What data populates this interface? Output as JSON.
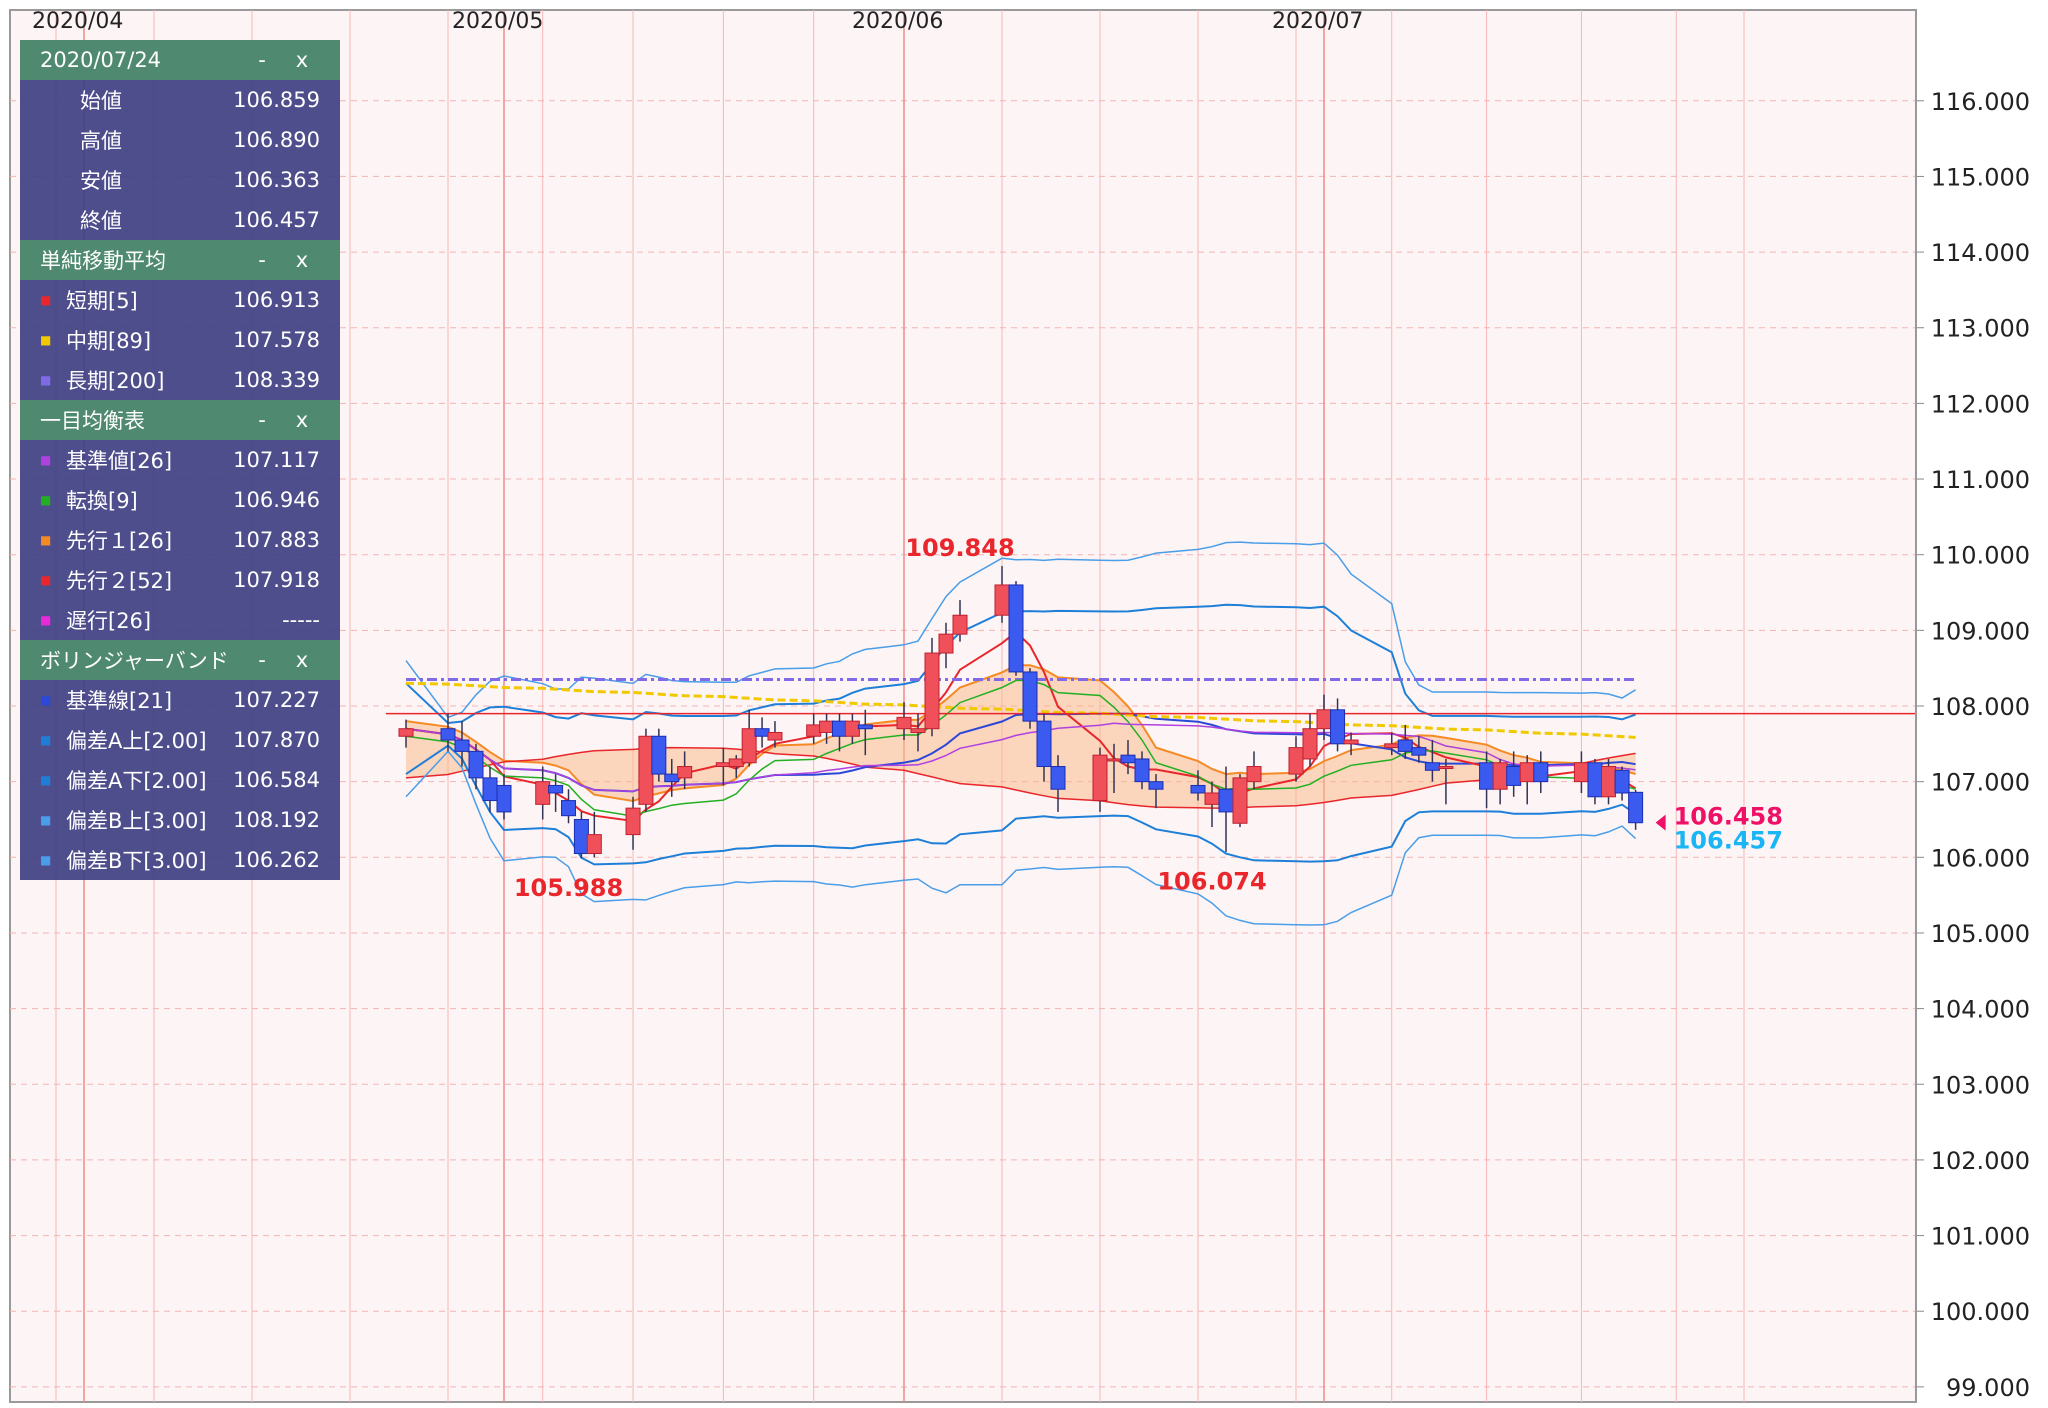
{
  "chart_data": {
    "type": "candlestick",
    "ylim": [
      98.8,
      117.2
    ],
    "y_ticks": [
      "99.000",
      "100.000",
      "101.000",
      "102.000",
      "103.000",
      "104.000",
      "105.000",
      "106.000",
      "107.000",
      "108.000",
      "109.000",
      "110.000",
      "111.000",
      "112.000",
      "113.000",
      "114.000",
      "115.000",
      "116.000"
    ],
    "x_month_labels": [
      "2020/04",
      "2020/05",
      "2020/06",
      "2020/07"
    ],
    "grid": true,
    "annotations": [
      {
        "text": "109.848",
        "x": "2020/06/05",
        "y": 109.848,
        "color": "#e8262b"
      },
      {
        "text": "105.988",
        "x": "2020/05/06",
        "y": 105.988,
        "color": "#e8262b"
      },
      {
        "text": "106.074",
        "x": "2020/06/23",
        "y": 106.074,
        "color": "#e8262b"
      }
    ],
    "price_labels": {
      "bid": "106.458",
      "ask": "106.457",
      "bid_color": "#ee1166",
      "ask_color": "#1ab5f5"
    },
    "horizontal_line": {
      "value": 107.9,
      "color": "#e8262b"
    },
    "candles": [
      {
        "d": "2020/04/24",
        "o": 107.6,
        "h": 107.82,
        "l": 107.45,
        "c": 107.7
      },
      {
        "d": "2020/04/27",
        "o": 107.7,
        "h": 107.9,
        "l": 107.4,
        "c": 107.55
      },
      {
        "d": "2020/04/28",
        "o": 107.55,
        "h": 107.8,
        "l": 107.2,
        "c": 107.4
      },
      {
        "d": "2020/04/29",
        "o": 107.4,
        "h": 107.5,
        "l": 106.9,
        "c": 107.05
      },
      {
        "d": "2020/04/30",
        "o": 107.05,
        "h": 107.2,
        "l": 106.6,
        "c": 106.75
      },
      {
        "d": "2020/05/01",
        "o": 106.95,
        "h": 107.1,
        "l": 106.5,
        "c": 106.6
      },
      {
        "d": "2020/05/04",
        "o": 106.7,
        "h": 107.2,
        "l": 106.5,
        "c": 107.0
      },
      {
        "d": "2020/05/05",
        "o": 106.95,
        "h": 107.1,
        "l": 106.6,
        "c": 106.85
      },
      {
        "d": "2020/05/06",
        "o": 106.75,
        "h": 106.9,
        "l": 106.45,
        "c": 106.55
      },
      {
        "d": "2020/05/07",
        "o": 106.5,
        "h": 106.6,
        "l": 105.99,
        "c": 106.05
      },
      {
        "d": "2020/05/08",
        "o": 106.05,
        "h": 106.6,
        "l": 106.0,
        "c": 106.3
      },
      {
        "d": "2020/05/11",
        "o": 106.3,
        "h": 106.8,
        "l": 106.1,
        "c": 106.65
      },
      {
        "d": "2020/05/12",
        "o": 106.7,
        "h": 107.7,
        "l": 106.6,
        "c": 107.6
      },
      {
        "d": "2020/05/13",
        "o": 107.6,
        "h": 107.7,
        "l": 107.0,
        "c": 107.1
      },
      {
        "d": "2020/05/14",
        "o": 107.1,
        "h": 107.3,
        "l": 106.8,
        "c": 107.0
      },
      {
        "d": "2020/05/15",
        "o": 107.05,
        "h": 107.4,
        "l": 106.9,
        "c": 107.2
      },
      {
        "d": "2020/05/18",
        "o": 107.2,
        "h": 107.45,
        "l": 106.95,
        "c": 107.25
      },
      {
        "d": "2020/05/19",
        "o": 107.2,
        "h": 107.35,
        "l": 107.05,
        "c": 107.3
      },
      {
        "d": "2020/05/20",
        "o": 107.25,
        "h": 107.95,
        "l": 107.2,
        "c": 107.7
      },
      {
        "d": "2020/05/21",
        "o": 107.7,
        "h": 107.85,
        "l": 107.45,
        "c": 107.6
      },
      {
        "d": "2020/05/22",
        "o": 107.55,
        "h": 107.8,
        "l": 107.45,
        "c": 107.65
      },
      {
        "d": "2020/05/25",
        "o": 107.6,
        "h": 107.9,
        "l": 107.5,
        "c": 107.75
      },
      {
        "d": "2020/05/26",
        "o": 107.65,
        "h": 107.9,
        "l": 107.5,
        "c": 107.8
      },
      {
        "d": "2020/05/27",
        "o": 107.8,
        "h": 107.9,
        "l": 107.4,
        "c": 107.6
      },
      {
        "d": "2020/05/28",
        "o": 107.6,
        "h": 107.9,
        "l": 107.5,
        "c": 107.8
      },
      {
        "d": "2020/05/29",
        "o": 107.75,
        "h": 107.95,
        "l": 107.35,
        "c": 107.7
      },
      {
        "d": "2020/06/01",
        "o": 107.7,
        "h": 108.05,
        "l": 107.55,
        "c": 107.85
      },
      {
        "d": "2020/06/02",
        "o": 107.65,
        "h": 107.9,
        "l": 107.4,
        "c": 107.7
      },
      {
        "d": "2020/06/03",
        "o": 107.7,
        "h": 108.9,
        "l": 107.6,
        "c": 108.7
      },
      {
        "d": "2020/06/04",
        "o": 108.7,
        "h": 109.1,
        "l": 108.5,
        "c": 108.95
      },
      {
        "d": "2020/06/05",
        "o": 108.95,
        "h": 109.4,
        "l": 108.85,
        "c": 109.2
      },
      {
        "d": "2020/06/08",
        "o": 109.2,
        "h": 109.85,
        "l": 109.1,
        "c": 109.6
      },
      {
        "d": "2020/06/09",
        "o": 109.6,
        "h": 109.65,
        "l": 108.4,
        "c": 108.45
      },
      {
        "d": "2020/06/10",
        "o": 108.45,
        "h": 108.5,
        "l": 107.7,
        "c": 107.8
      },
      {
        "d": "2020/06/11",
        "o": 107.8,
        "h": 107.9,
        "l": 107.0,
        "c": 107.2
      },
      {
        "d": "2020/06/12",
        "o": 107.2,
        "h": 107.35,
        "l": 106.6,
        "c": 106.9
      },
      {
        "d": "2020/06/15",
        "o": 106.75,
        "h": 107.45,
        "l": 106.6,
        "c": 107.35
      },
      {
        "d": "2020/06/16",
        "o": 107.3,
        "h": 107.5,
        "l": 106.85,
        "c": 107.3
      },
      {
        "d": "2020/06/17",
        "o": 107.35,
        "h": 107.55,
        "l": 107.1,
        "c": 107.25
      },
      {
        "d": "2020/06/18",
        "o": 107.3,
        "h": 107.4,
        "l": 106.9,
        "c": 107.0
      },
      {
        "d": "2020/06/19",
        "o": 107.0,
        "h": 107.1,
        "l": 106.65,
        "c": 106.9
      },
      {
        "d": "2020/06/22",
        "o": 106.95,
        "h": 107.15,
        "l": 106.75,
        "c": 106.85
      },
      {
        "d": "2020/06/23",
        "o": 106.7,
        "h": 107.0,
        "l": 106.4,
        "c": 106.85
      },
      {
        "d": "2020/06/24",
        "o": 106.9,
        "h": 107.2,
        "l": 106.07,
        "c": 106.6
      },
      {
        "d": "2020/06/25",
        "o": 106.45,
        "h": 107.1,
        "l": 106.4,
        "c": 107.05
      },
      {
        "d": "2020/06/26",
        "o": 107.0,
        "h": 107.4,
        "l": 106.9,
        "c": 107.2
      },
      {
        "d": "2020/06/29",
        "o": 107.1,
        "h": 107.6,
        "l": 107.0,
        "c": 107.45
      },
      {
        "d": "2020/06/30",
        "o": 107.3,
        "h": 107.9,
        "l": 107.2,
        "c": 107.7
      },
      {
        "d": "2020/07/01",
        "o": 107.7,
        "h": 108.15,
        "l": 107.55,
        "c": 107.95
      },
      {
        "d": "2020/07/02",
        "o": 107.95,
        "h": 108.1,
        "l": 107.4,
        "c": 107.5
      },
      {
        "d": "2020/07/03",
        "o": 107.5,
        "h": 107.65,
        "l": 107.35,
        "c": 107.55
      },
      {
        "d": "2020/07/06",
        "o": 107.45,
        "h": 107.65,
        "l": 107.35,
        "c": 107.5
      },
      {
        "d": "2020/07/07",
        "o": 107.55,
        "h": 107.75,
        "l": 107.3,
        "c": 107.4
      },
      {
        "d": "2020/07/08",
        "o": 107.45,
        "h": 107.6,
        "l": 107.25,
        "c": 107.35
      },
      {
        "d": "2020/07/09",
        "o": 107.25,
        "h": 107.55,
        "l": 107.0,
        "c": 107.15
      },
      {
        "d": "2020/07/10",
        "o": 107.2,
        "h": 107.3,
        "l": 106.7,
        "c": 107.2
      },
      {
        "d": "2020/07/13",
        "o": 107.25,
        "h": 107.4,
        "l": 106.65,
        "c": 106.9
      },
      {
        "d": "2020/07/14",
        "o": 106.9,
        "h": 107.3,
        "l": 106.7,
        "c": 107.25
      },
      {
        "d": "2020/07/15",
        "o": 107.2,
        "h": 107.4,
        "l": 106.8,
        "c": 106.95
      },
      {
        "d": "2020/07/16",
        "o": 107.0,
        "h": 107.35,
        "l": 106.7,
        "c": 107.25
      },
      {
        "d": "2020/07/17",
        "o": 107.25,
        "h": 107.4,
        "l": 106.85,
        "c": 107.0
      },
      {
        "d": "2020/07/20",
        "o": 107.0,
        "h": 107.4,
        "l": 106.85,
        "c": 107.25
      },
      {
        "d": "2020/07/21",
        "o": 107.25,
        "h": 107.3,
        "l": 106.7,
        "c": 106.8
      },
      {
        "d": "2020/07/22",
        "o": 106.8,
        "h": 107.3,
        "l": 106.7,
        "c": 107.2
      },
      {
        "d": "2020/07/23",
        "o": 107.15,
        "h": 107.2,
        "l": 106.75,
        "c": 106.85
      },
      {
        "d": "2020/07/24",
        "o": 106.859,
        "h": 106.89,
        "l": 106.363,
        "c": 106.457
      }
    ]
  },
  "panel": {
    "controls": {
      "minimize": "-",
      "close": "x"
    },
    "ohlc": {
      "date": "2020/07/24",
      "rows": [
        {
          "label": "始値",
          "value": "106.859"
        },
        {
          "label": "高値",
          "value": "106.890"
        },
        {
          "label": "安値",
          "value": "106.363"
        },
        {
          "label": "終値",
          "value": "106.457"
        }
      ]
    },
    "sma": {
      "title": "単純移動平均",
      "rows": [
        {
          "label": "短期[5]",
          "value": "106.913",
          "color": "#e8262b"
        },
        {
          "label": "中期[89]",
          "value": "107.578",
          "color": "#f2c800"
        },
        {
          "label": "長期[200]",
          "value": "108.339",
          "color": "#7f6be8"
        }
      ]
    },
    "ichimoku": {
      "title": "一目均衡表",
      "rows": [
        {
          "label": "基準値[26]",
          "value": "107.117",
          "color": "#b040e0"
        },
        {
          "label": "転換[9]",
          "value": "106.946",
          "color": "#22b022"
        },
        {
          "label": "先行１[26]",
          "value": "107.883",
          "color": "#f58a25"
        },
        {
          "label": "先行２[52]",
          "value": "107.918",
          "color": "#e8262b"
        },
        {
          "label": "遅行[26]",
          "value": "-----",
          "color": "#e82ad8"
        }
      ]
    },
    "bollinger": {
      "title": "ボリンジャーバンド",
      "rows": [
        {
          "label": "基準線[21]",
          "value": "107.227",
          "color": "#2b48d8"
        },
        {
          "label": "偏差A上[2.00]",
          "value": "107.870",
          "color": "#1e7fd8"
        },
        {
          "label": "偏差A下[2.00]",
          "value": "106.584",
          "color": "#1e7fd8"
        },
        {
          "label": "偏差B上[3.00]",
          "value": "108.192",
          "color": "#4a9de8"
        },
        {
          "label": "偏差B下[3.00]",
          "value": "106.262",
          "color": "#4a9de8"
        }
      ]
    }
  }
}
